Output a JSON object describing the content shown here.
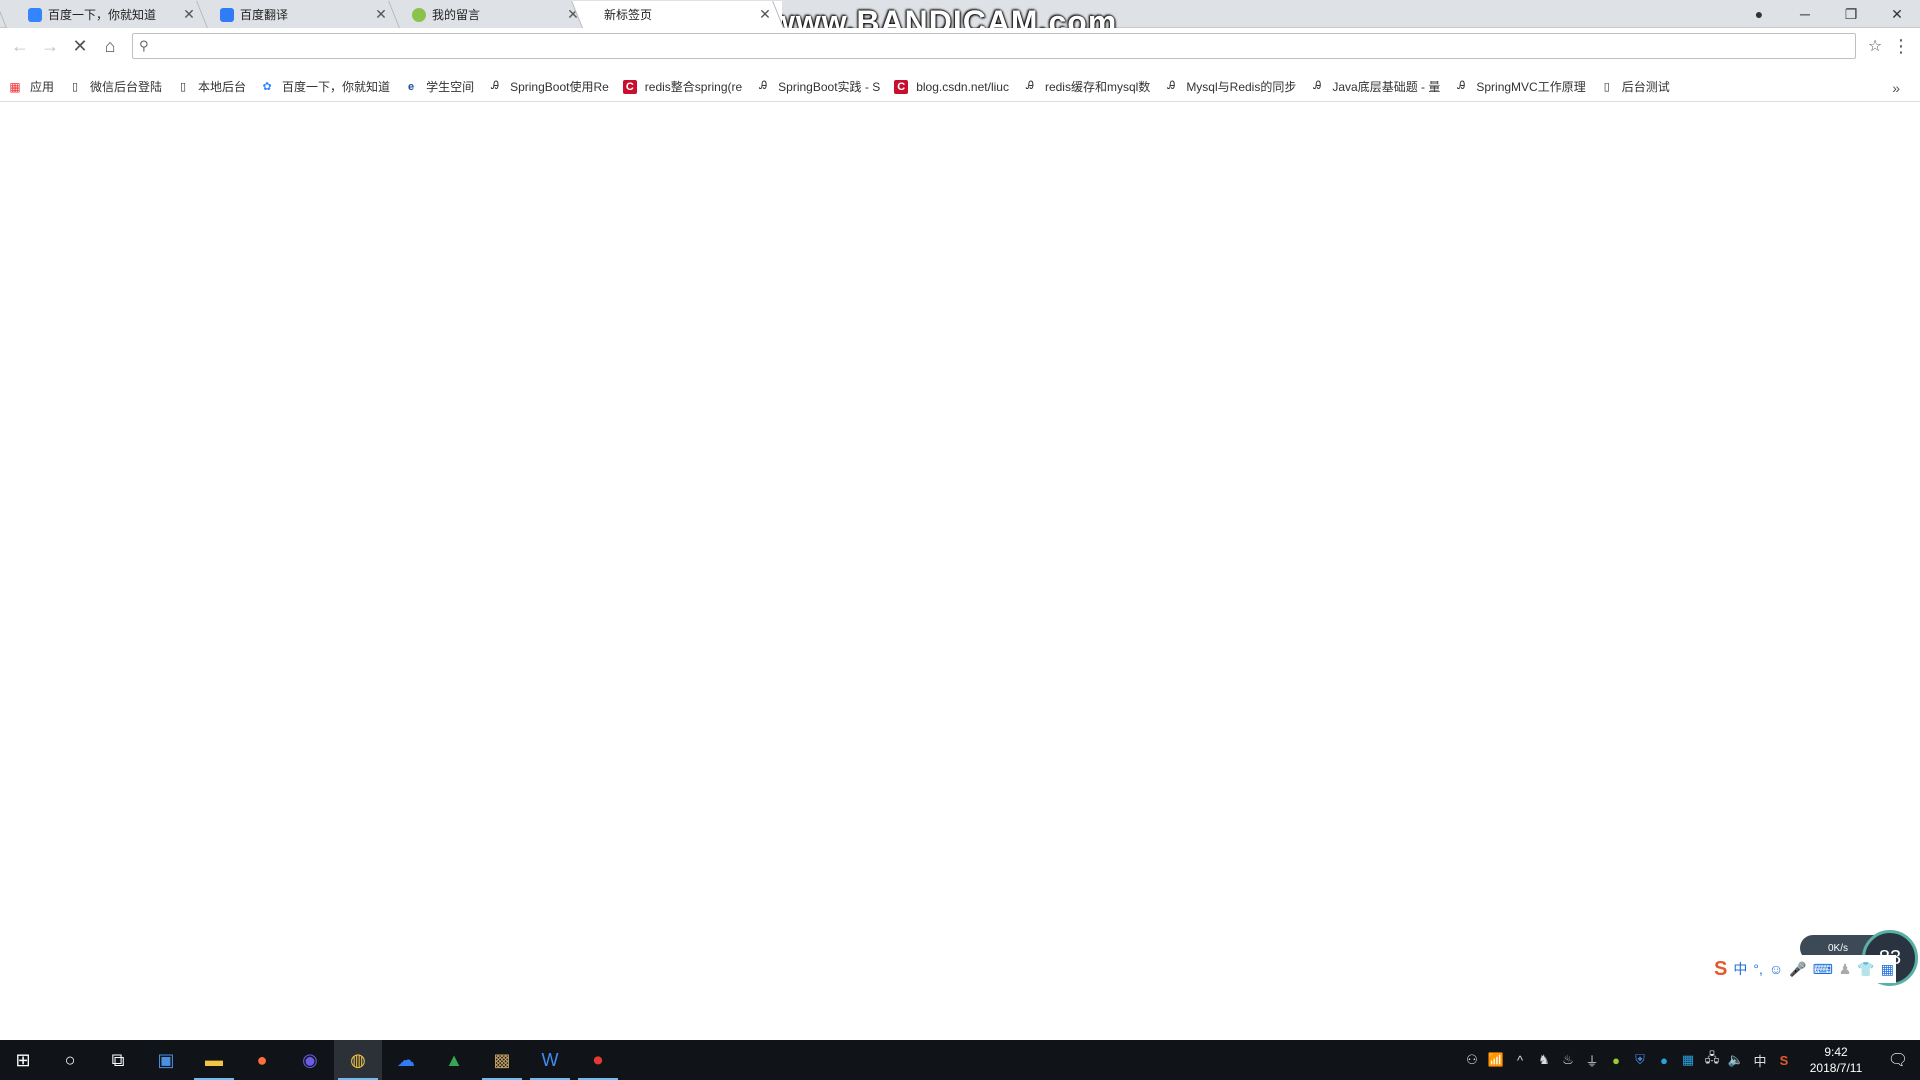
{
  "tabs": [
    {
      "title": "百度一下，你就知道",
      "favicon_color": "#3385ff",
      "icon": "baidu-paw-icon",
      "active": false
    },
    {
      "title": "百度翻译",
      "favicon_color": "#2f7cf6",
      "icon": "baidu-translate-icon",
      "active": false
    },
    {
      "title": "我的留言",
      "favicon_color": "#8bc34a",
      "icon": "leaf-icon",
      "active": false
    },
    {
      "title": "新标签页",
      "favicon_color": "",
      "icon": "",
      "active": true
    }
  ],
  "watermark": "www.BANDICAM.com",
  "omnibox": {
    "value": "",
    "placeholder": ""
  },
  "bookmarks": [
    {
      "label": "应用",
      "icon": "apps-grid-icon"
    },
    {
      "label": "微信后台登陆",
      "icon": "page-icon"
    },
    {
      "label": "本地后台",
      "icon": "page-icon"
    },
    {
      "label": "百度一下，你就知道",
      "icon": "baidu-paw-icon"
    },
    {
      "label": "学生空间",
      "icon": "e-logo-icon"
    },
    {
      "label": "SpringBoot使用Re",
      "icon": "juejin-icon"
    },
    {
      "label": "redis整合spring(re",
      "icon": "csdn-icon"
    },
    {
      "label": "SpringBoot实践 - S",
      "icon": "juejin-icon"
    },
    {
      "label": "blog.csdn.net/liuc",
      "icon": "csdn-icon"
    },
    {
      "label": "redis缓存和mysql数",
      "icon": "juejin-icon"
    },
    {
      "label": "Mysql与Redis的同步",
      "icon": "juejin-icon"
    },
    {
      "label": "Java底层基础题 - 量",
      "icon": "juejin-icon"
    },
    {
      "label": "SpringMVC工作原理",
      "icon": "juejin-icon"
    },
    {
      "label": "后台测试",
      "icon": "page-icon"
    }
  ],
  "ime": {
    "lang": "中"
  },
  "netmon": {
    "speed": "0K/s",
    "value": "83"
  },
  "tray": {
    "time": "9:42",
    "date": "2018/7/11",
    "input_lang": "中"
  }
}
